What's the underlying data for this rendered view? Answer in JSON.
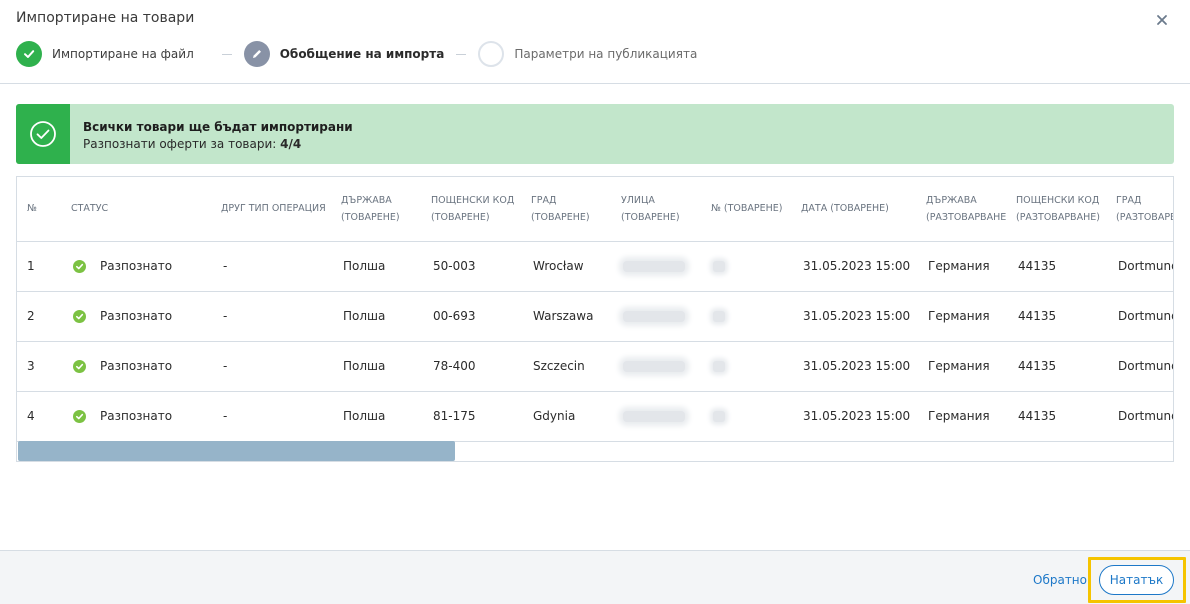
{
  "dialog": {
    "title": "Импортиране на товари"
  },
  "steps": [
    {
      "label": "Импортиране на файл",
      "state": "done",
      "icon": "check-icon"
    },
    {
      "label": "Обобщение на импорта",
      "state": "active",
      "icon": "pencil-icon"
    },
    {
      "label": "Параметри на публикацията",
      "state": "pending",
      "icon": ""
    }
  ],
  "banner": {
    "title": "Всички товари ще бъдат импортирани",
    "subtitle": "Разпознати оферти за товари:",
    "count": "4/4",
    "icon": "check-circle-icon"
  },
  "table": {
    "headers": [
      [
        "№",
        ""
      ],
      [
        "Статус",
        ""
      ],
      [
        "Друг тип операция",
        ""
      ],
      [
        "Държава",
        "(товарене)"
      ],
      [
        "Пощенски код",
        "(товарене)"
      ],
      [
        "Град",
        "(товарене)"
      ],
      [
        "Улица",
        "(товарене)"
      ],
      [
        "№ (товарене)",
        ""
      ],
      [
        "Дата (товарене)",
        ""
      ],
      [
        "Държава",
        "(разтоварване)"
      ],
      [
        "Пощенски код",
        "(разтоварване)"
      ],
      [
        "Град",
        "(разтоварва"
      ]
    ],
    "rows": [
      {
        "num": "1",
        "status": "Разпознато",
        "other": "-",
        "country_load": "Полша",
        "zip_load": "50-003",
        "city_load": "Wrocław",
        "date_load": "31.05.2023 15:00",
        "country_unload": "Германия",
        "zip_unload": "44135",
        "city_unload": "Dortmund"
      },
      {
        "num": "2",
        "status": "Разпознато",
        "other": "-",
        "country_load": "Полша",
        "zip_load": "00-693",
        "city_load": "Warszawa",
        "date_load": "31.05.2023 15:00",
        "country_unload": "Германия",
        "zip_unload": "44135",
        "city_unload": "Dortmund"
      },
      {
        "num": "3",
        "status": "Разпознато",
        "other": "-",
        "country_load": "Полша",
        "zip_load": "78-400",
        "city_load": "Szczecin",
        "date_load": "31.05.2023 15:00",
        "country_unload": "Германия",
        "zip_unload": "44135",
        "city_unload": "Dortmund"
      },
      {
        "num": "4",
        "status": "Разпознато",
        "other": "-",
        "country_load": "Полша",
        "zip_load": "81-175",
        "city_load": "Gdynia",
        "date_load": "31.05.2023 15:00",
        "country_unload": "Германия",
        "zip_unload": "44135",
        "city_unload": "Dortmund"
      }
    ]
  },
  "footer": {
    "back_label": "Обратно",
    "next_label": "Нататък"
  },
  "colors": {
    "success": "#2fb14d",
    "success_light": "#c2e6cb",
    "status_dot": "#7cc243",
    "step_active": "#8892a6",
    "link": "#1d78c8",
    "highlight": "#f5c400",
    "scrollbar": "#96b4c9"
  }
}
